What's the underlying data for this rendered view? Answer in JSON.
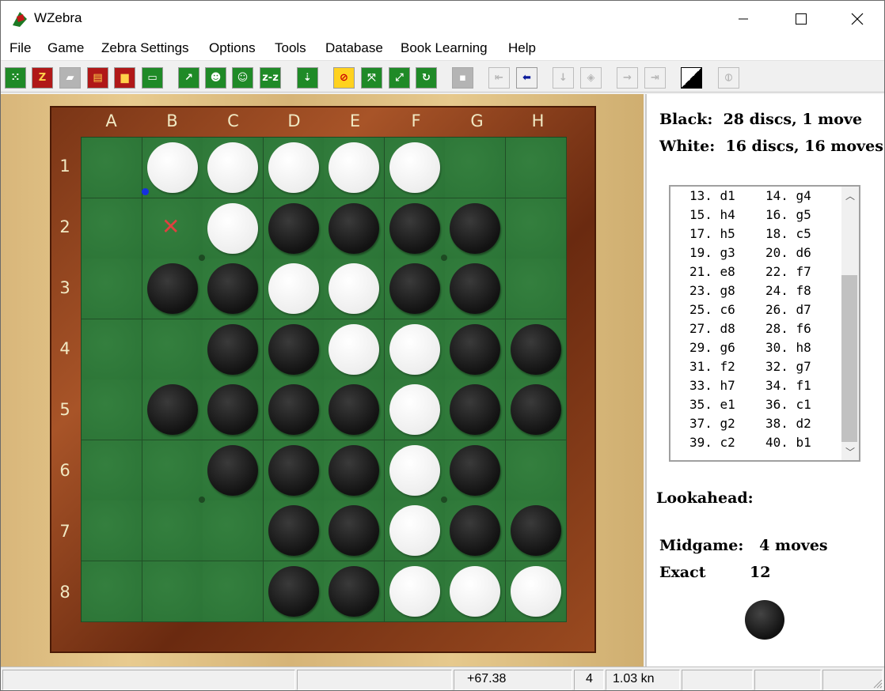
{
  "window": {
    "title": "WZebra"
  },
  "menu": [
    "File",
    "Game",
    "Zebra Settings",
    "Options",
    "Tools",
    "Database",
    "Book Learning",
    "Help"
  ],
  "toolbar": {
    "buttons": [
      {
        "name": "new-game-icon",
        "label": "⁙",
        "style": "green"
      },
      {
        "name": "zebra-book-icon",
        "label": "Z",
        "style": "red"
      },
      {
        "name": "erase-icon",
        "label": "▰",
        "style": "gray"
      },
      {
        "name": "book-icon",
        "label": "▤",
        "style": "red"
      },
      {
        "name": "save-icon",
        "label": "▆",
        "style": "red"
      },
      {
        "name": "open-folder-icon",
        "label": "▭",
        "style": "green"
      },
      {
        "name": "move-icon",
        "label": "↗",
        "style": "green"
      },
      {
        "name": "person-icon",
        "label": "☻",
        "style": "green"
      },
      {
        "name": "person-think-icon",
        "label": "☺",
        "style": "green"
      },
      {
        "name": "zz-icon",
        "label": "z-z",
        "style": "green"
      },
      {
        "name": "download-icon",
        "label": "⇣",
        "style": "green"
      },
      {
        "name": "no-icon",
        "label": "⊘",
        "style": "yellow"
      },
      {
        "name": "flip-icon",
        "label": "⤧",
        "style": "green"
      },
      {
        "name": "rotate-icon",
        "label": "⤢",
        "style": "green"
      },
      {
        "name": "refresh-icon",
        "label": "↻",
        "style": "green"
      },
      {
        "name": "blank-icon",
        "label": "▪",
        "style": "gray"
      },
      {
        "name": "first-move-icon",
        "label": "⇤",
        "style": "dis"
      },
      {
        "name": "back-icon",
        "label": "⬅",
        "style": "plain"
      },
      {
        "name": "down-icon",
        "label": "↓",
        "style": "dis"
      },
      {
        "name": "hint-icon",
        "label": "◈",
        "style": "dis"
      },
      {
        "name": "forward-icon",
        "label": "→",
        "style": "dis"
      },
      {
        "name": "last-move-icon",
        "label": "⇥",
        "style": "dis"
      },
      {
        "name": "swap-colors-icon",
        "label": "",
        "style": "bw"
      },
      {
        "name": "stop-icon",
        "label": "⦶",
        "style": "dis"
      }
    ]
  },
  "board": {
    "columns": [
      "A",
      "B",
      "C",
      "D",
      "E",
      "F",
      "G",
      "H"
    ],
    "rows": [
      "1",
      "2",
      "3",
      "4",
      "5",
      "6",
      "7",
      "8"
    ],
    "cells": [
      "-WWWWW--",
      "--WBBBB-",
      "-BBWWBB-",
      "--BBWWBB",
      "-BBBBWBB",
      "--BBBWB-",
      "---BBWBB",
      "---BBWWW"
    ],
    "last_move": "b1",
    "hint_mark": "b2"
  },
  "stats": {
    "black": "Black:  28 discs, 1 move",
    "white": "White:  16 discs, 16 moves"
  },
  "moves": [
    [
      "13. d1",
      "14. g4"
    ],
    [
      "15. h4",
      "16. g5"
    ],
    [
      "17. h5",
      "18. c5"
    ],
    [
      "19. g3",
      "20. d6"
    ],
    [
      "21. e8",
      "22. f7"
    ],
    [
      "23. g8",
      "24. f8"
    ],
    [
      "25. c6",
      "26. d7"
    ],
    [
      "27. d8",
      "28. f6"
    ],
    [
      "29. g6",
      "30. h8"
    ],
    [
      "31. f2",
      "32. g7"
    ],
    [
      "33. h7",
      "34. f1"
    ],
    [
      "35. e1",
      "36. c1"
    ],
    [
      "37. g2",
      "38. d2"
    ],
    [
      "39. c2",
      "40. b1"
    ]
  ],
  "lookahead": {
    "label": "Lookahead:",
    "midgame": "Midgame:   4 moves",
    "exact_label": "Exact",
    "exact_value": "12"
  },
  "side_to_move": "black",
  "status": {
    "panels": [
      "",
      "",
      "+67.38",
      "4",
      "1.03 kn",
      "",
      "",
      ""
    ]
  }
}
